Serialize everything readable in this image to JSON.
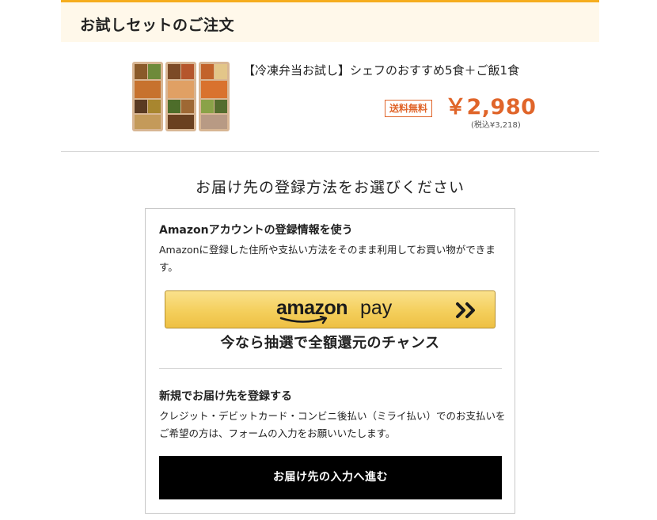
{
  "order": {
    "title": "お試しセットのご注文"
  },
  "product": {
    "name": "【冷凍弁当お試し】シェフのおすすめ5食＋ご飯1食",
    "shipping_badge": "送料無料",
    "price": "￥2,980",
    "price_tax": "(税込¥3,218)"
  },
  "delivery": {
    "heading": "お届け先の登録方法をお選びください",
    "amazon_option": {
      "title": "Amazonアカウントの登録情報を使う",
      "description": "Amazonに登録した住所や支払い方法をそのまま利用してお買い物ができます。",
      "button_brand": "amazon",
      "button_pay": "pay",
      "campaign": "今なら抽選で全額還元のチャンス"
    },
    "new_option": {
      "title": "新規でお届け先を登録する",
      "description": "クレジット・デビットカード・コンビニ後払い（ミライ払い）でのお支払いをご希望の方は、フォームの入力をお願いいたします。",
      "button_label": "お届け先の入力へ進む"
    }
  },
  "colors": {
    "accent_orange": "#e0652a",
    "header_border": "#f5ad1e",
    "header_bg": "#fff8ea",
    "amazon_button": "#f4cf5c",
    "primary_button": "#000000"
  },
  "icons": {
    "amazon_smile": "amazon-smile-arrow-icon",
    "amazon_chevrons": "double-chevron-right-icon"
  }
}
